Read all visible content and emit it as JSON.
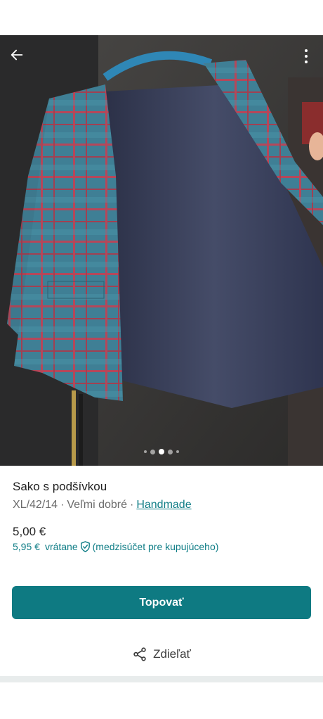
{
  "listing": {
    "title": "Sako s podšívkou",
    "size": "XL/42/14",
    "condition": "Veľmi dobré",
    "brand": "Handmade",
    "separator": "·"
  },
  "pricing": {
    "price": "5,00 €",
    "buyer_price": "5,95 €",
    "included_label": "vrátane",
    "protection_label": "(medzisúčet pre kupujúceho)"
  },
  "actions": {
    "bump_label": "Topovať",
    "share_label": "Zdieľať"
  },
  "gallery": {
    "photo_count": 5,
    "active_index": 2
  },
  "colors": {
    "accent": "#0e7a82",
    "link": "#0f7d86"
  },
  "icons": {
    "back": "arrow-left-icon",
    "more": "more-vertical-icon",
    "shield": "shield-check-icon",
    "share": "share-icon"
  }
}
